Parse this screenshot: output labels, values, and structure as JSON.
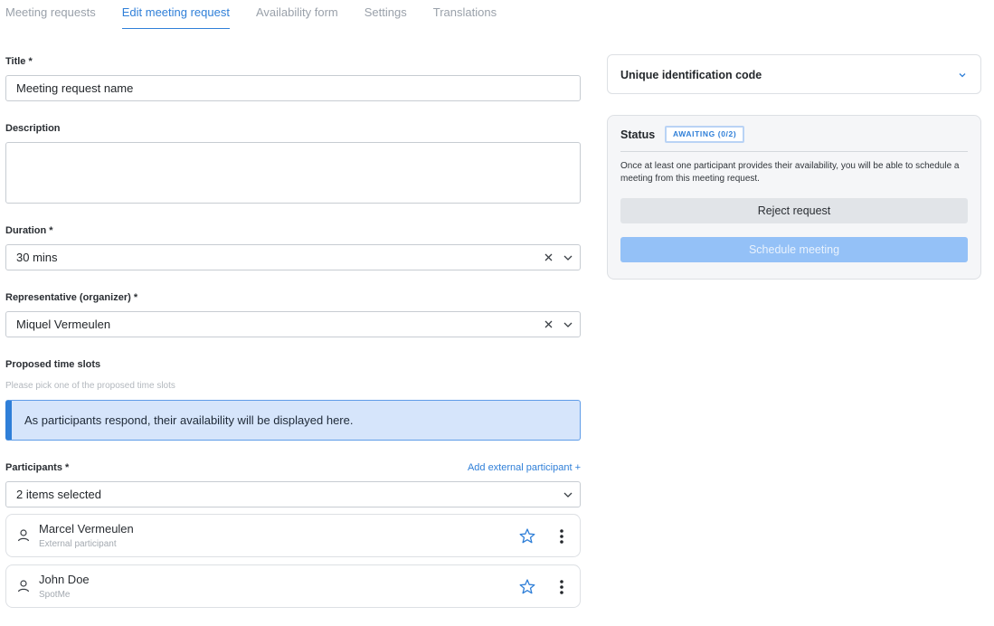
{
  "tabs": [
    {
      "label": "Meeting requests",
      "active": false
    },
    {
      "label": "Edit meeting request",
      "active": true
    },
    {
      "label": "Availability form",
      "active": false
    },
    {
      "label": "Settings",
      "active": false
    },
    {
      "label": "Translations",
      "active": false
    }
  ],
  "form": {
    "title_label": "Title *",
    "title_value": "Meeting request name",
    "description_label": "Description",
    "description_value": "",
    "duration_label": "Duration *",
    "duration_value": "30 mins",
    "representative_label": "Representative (organizer) *",
    "representative_value": "Miquel Vermeulen",
    "timeslots_label": "Proposed time slots",
    "timeslots_hint": "Please pick one of the proposed time slots",
    "timeslots_info": "As participants respond, their availability will be displayed here.",
    "participants_label": "Participants *",
    "add_external_link": "Add external participant +",
    "participants_select_value": "2 items selected"
  },
  "participants": [
    {
      "name": "Marcel Vermeulen",
      "subtitle": "External participant"
    },
    {
      "name": "John Doe",
      "subtitle": "SpotMe"
    }
  ],
  "right_panel": {
    "uid_title": "Unique identification code",
    "status_title": "Status",
    "status_badge": "AWAITING (0/2)",
    "status_text": "Once at least one participant provides their availability, you will be able to schedule a meeting from this meeting request.",
    "reject_button": "Reject request",
    "schedule_button": "Schedule meeting"
  },
  "colors": {
    "accent": "#2f7fd8",
    "info_bg": "#d6e5fb",
    "schedule_disabled": "#94c1f7"
  }
}
